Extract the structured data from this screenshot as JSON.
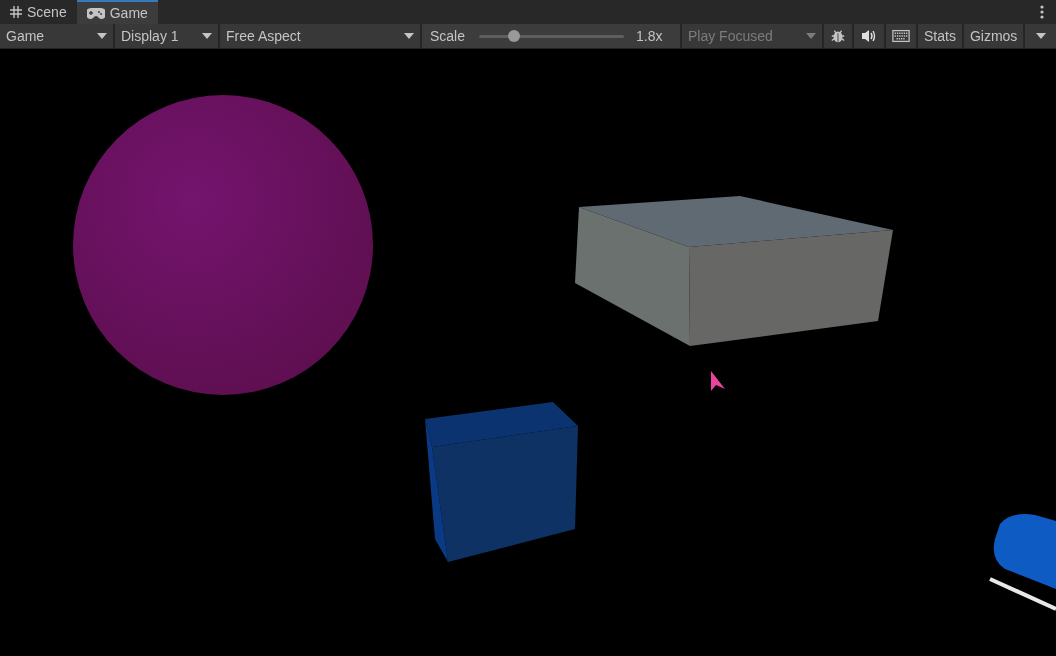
{
  "tabs": [
    {
      "label": "Scene",
      "kind": "grid",
      "selected": false
    },
    {
      "label": "Game",
      "kind": "gamepad",
      "selected": true
    }
  ],
  "toolbar": {
    "dropdowns": [
      {
        "label": "Game"
      },
      {
        "label": "Display 1"
      },
      {
        "label": "Free Aspect"
      }
    ],
    "scale": {
      "label": "Scale",
      "level": 0.24,
      "reading": "1.8x"
    },
    "play_mode": {
      "label": "Play Focused",
      "disabled": true
    },
    "icon_buttons": [
      {
        "kind": "bug"
      },
      {
        "kind": "speaker"
      },
      {
        "kind": "keyboard"
      }
    ],
    "stats": "Stats",
    "gizmos": "Gizmos"
  }
}
